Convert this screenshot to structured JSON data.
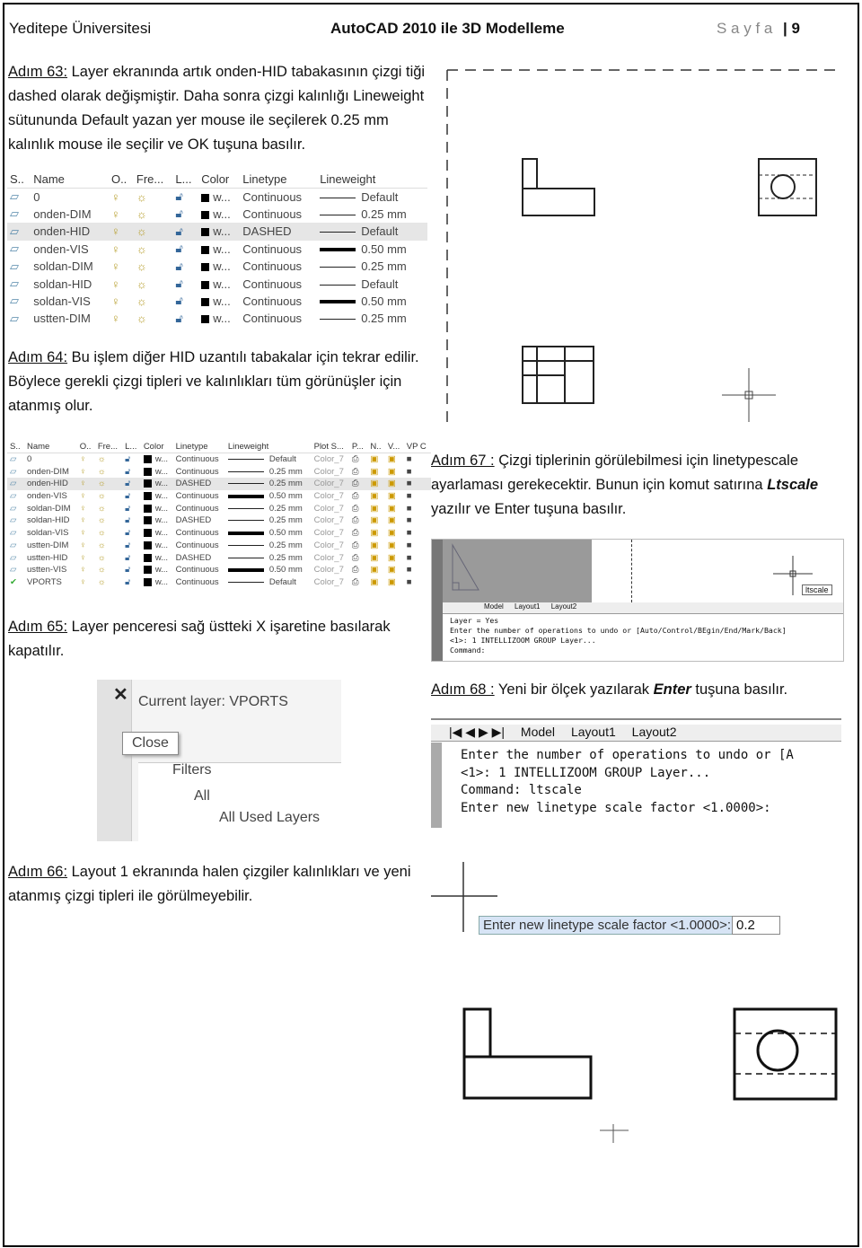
{
  "header": {
    "left": "Yeditepe Üniversitesi",
    "center": "AutoCAD 2010 ile 3D Modelleme",
    "page_label": "S a y f a",
    "page_number": "| 9"
  },
  "steps": [
    {
      "label": "Adım 63:",
      "text": " Layer ekranında artık onden-HID tabakasının çizgi tiği dashed olarak değişmiştir.  Daha sonra çizgi kalınlığı Lineweight sütununda Default yazan yer mouse ile seçilerek 0.25 mm kalınlık mouse ile seçilir ve OK tuşuna basılır."
    },
    {
      "label": "Adım 64:",
      "text": " Bu işlem diğer HID uzantılı tabakalar için tekrar edilir. Böylece gerekli çizgi tipleri ve kalınlıkları tüm görünüşler için atanmış olur."
    },
    {
      "label": "Adım 65:",
      "text": " Layer penceresi sağ üstteki X işaretine basılarak kapatılır."
    },
    {
      "label": "Adım 66:",
      "text": " Layout 1 ekranında halen çizgiler kalınlıkları ve yeni atanmış çizgi tipleri ile görülmeyebilir."
    },
    {
      "label": "Adım 67 :",
      "text": " Çizgi tiplerinin görülebilmesi için linetypescale ayarlaması gerekecektir. Bunun için komut satırına ",
      "bold": "Ltscale",
      "text2": " yazılır ve Enter tuşuna basılır."
    },
    {
      "label": "Adım 68 :",
      "text": " Yeni bir ölçek yazılarak ",
      "bold": "Enter",
      "text2": " tuşuna basılır."
    }
  ],
  "layer_table_1": {
    "columns": [
      "S..",
      "Name",
      "O..",
      "Fre...",
      "L...",
      "Color",
      "Linetype",
      "Lineweight"
    ],
    "rows": [
      {
        "name": "0",
        "color": "w...",
        "linetype": "Continuous",
        "lineweight": "Default",
        "bold": false
      },
      {
        "name": "onden-DIM",
        "color": "w...",
        "linetype": "Continuous",
        "lineweight": "0.25 mm",
        "bold": false
      },
      {
        "name": "onden-HID",
        "color": "w...",
        "linetype": "DASHED",
        "lineweight": "Default",
        "bold": false,
        "selected": true
      },
      {
        "name": "onden-VIS",
        "color": "w...",
        "linetype": "Continuous",
        "lineweight": "0.50 mm",
        "bold": true
      },
      {
        "name": "soldan-DIM",
        "color": "w...",
        "linetype": "Continuous",
        "lineweight": "0.25 mm",
        "bold": false
      },
      {
        "name": "soldan-HID",
        "color": "w...",
        "linetype": "Continuous",
        "lineweight": "Default",
        "bold": false
      },
      {
        "name": "soldan-VIS",
        "color": "w...",
        "linetype": "Continuous",
        "lineweight": "0.50 mm",
        "bold": true
      },
      {
        "name": "ustten-DIM",
        "color": "w...",
        "linetype": "Continuous",
        "lineweight": "0.25 mm",
        "bold": false
      }
    ]
  },
  "layer_table_2": {
    "columns": [
      "S..",
      "Name",
      "O..",
      "Fre...",
      "L...",
      "Color",
      "Linetype",
      "Lineweight",
      "Plot S...",
      "P...",
      "N..",
      "V...",
      "VP C"
    ],
    "rows": [
      {
        "name": "0",
        "color": "w...",
        "linetype": "Continuous",
        "lineweight": "Default",
        "plot": "Color_7",
        "bold": false
      },
      {
        "name": "onden-DIM",
        "color": "w...",
        "linetype": "Continuous",
        "lineweight": "0.25 mm",
        "plot": "Color_7",
        "bold": false
      },
      {
        "name": "onden-HID",
        "color": "w...",
        "linetype": "DASHED",
        "lineweight": "0.25 mm",
        "plot": "Color_7",
        "bold": false,
        "selected": true
      },
      {
        "name": "onden-VIS",
        "color": "w...",
        "linetype": "Continuous",
        "lineweight": "0.50 mm",
        "plot": "Color_7",
        "bold": true
      },
      {
        "name": "soldan-DIM",
        "color": "w...",
        "linetype": "Continuous",
        "lineweight": "0.25 mm",
        "plot": "Color_7",
        "bold": false
      },
      {
        "name": "soldan-HID",
        "color": "w...",
        "linetype": "DASHED",
        "lineweight": "0.25 mm",
        "plot": "Color_7",
        "bold": false
      },
      {
        "name": "soldan-VIS",
        "color": "w...",
        "linetype": "Continuous",
        "lineweight": "0.50 mm",
        "plot": "Color_7",
        "bold": true
      },
      {
        "name": "ustten-DIM",
        "color": "w...",
        "linetype": "Continuous",
        "lineweight": "0.25 mm",
        "plot": "Color_7",
        "bold": false
      },
      {
        "name": "ustten-HID",
        "color": "w...",
        "linetype": "DASHED",
        "lineweight": "0.25 mm",
        "plot": "Color_7",
        "bold": false
      },
      {
        "name": "ustten-VIS",
        "color": "w...",
        "linetype": "Continuous",
        "lineweight": "0.50 mm",
        "plot": "Color_7",
        "bold": true
      },
      {
        "name": "VPORTS",
        "color": "w...",
        "linetype": "Continuous",
        "lineweight": "Default",
        "plot": "Color_7",
        "bold": false,
        "current": true
      }
    ]
  },
  "close_dialog": {
    "current_layer": "Current layer: VPORTS",
    "close_tooltip": "Close",
    "filters": "Filters",
    "all": "All",
    "all_used": "All Used Layers"
  },
  "cmd1": {
    "tabs": [
      "Model",
      "Layout1",
      "Layout2"
    ],
    "lines": [
      "Layer = Yes",
      "Enter the number of operations to undo or [Auto/Control/BEgin/End/Mark/Back]",
      "<1>: 1 INTELLIZOOM GROUP Layer...",
      "Command:"
    ],
    "input": "ltscale"
  },
  "cmd2": {
    "tabs": [
      "Model",
      "Layout1",
      "Layout2"
    ],
    "lines": [
      "Enter the number of operations to undo or [A",
      "<1>: 1 INTELLIZOOM GROUP Layer...",
      "Command: ltscale",
      "Enter new linetype scale factor <1.0000>:"
    ]
  },
  "dyn_prompt": {
    "label": "Enter new linetype scale factor <1.0000>:",
    "value": "0.2"
  }
}
